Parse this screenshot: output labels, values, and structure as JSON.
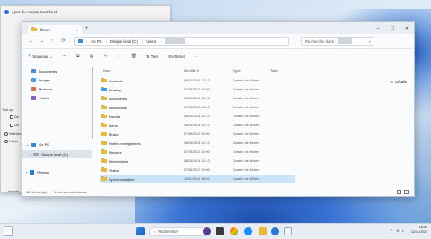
{
  "back_window": {
    "title": "Ajout du compte Nextcloud",
    "fragments": [
      "Tout sy",
      "De",
      "De",
      "Sélectio",
      "Utilise"
    ],
    "cancel_label": "Annule"
  },
  "explorer": {
    "tab_title": "dfenm",
    "tab_close": "×",
    "tab_add": "+",
    "window_controls": [
      "–",
      "☐",
      "✕"
    ],
    "nav_buttons": [
      "←",
      "→",
      "↑",
      "⟳"
    ],
    "breadcrumb": [
      "Ce PC",
      "Disque local (C:)",
      "Users"
    ],
    "breadcrumb_more": "›",
    "search_placeholder": "Rechercher dans :",
    "toolbar": {
      "new_label": "Nouveau",
      "sort_label": "Trier",
      "view_label": "Afficher",
      "more_label": "···",
      "details_label": "Détails"
    },
    "columns": {
      "name": "Nom",
      "modified": "Modifié le",
      "type": "Type",
      "size": "Taille"
    },
    "nav_pane": {
      "quick_access": [
        {
          "label": "Documents",
          "color": "#4a8fd6"
        },
        {
          "label": "Images",
          "color": "#49a0e0"
        },
        {
          "label": "Musique",
          "color": "#e0694a"
        },
        {
          "label": "Vidéos",
          "color": "#8a5bd6"
        }
      ],
      "this_pc": "Ce PC",
      "local_disk": "Disque local (C:)",
      "network": "Réseau"
    },
    "files": [
      {
        "name": "Contacts",
        "modified": "06/03/2024 12:10",
        "type": "Dossier de fichiers"
      },
      {
        "name": "Desktop",
        "modified": "07/05/2022 10:00",
        "type": "Dossier de fichiers"
      },
      {
        "name": "Documents",
        "modified": "06/03/2024 12:10",
        "type": "Dossier de fichiers"
      },
      {
        "name": "Downloads",
        "modified": "07/05/2022 10:00",
        "type": "Dossier de fichiers"
      },
      {
        "name": "Favoris",
        "modified": "06/03/2024 12:10",
        "type": "Dossier de fichiers"
      },
      {
        "name": "Liens",
        "modified": "06/03/2024 12:10",
        "type": "Dossier de fichiers"
      },
      {
        "name": "Music",
        "modified": "07/05/2022 10:00",
        "type": "Dossier de fichiers"
      },
      {
        "name": "Parties enregistrées",
        "modified": "06/03/2024 12:10",
        "type": "Dossier de fichiers"
      },
      {
        "name": "Pictures",
        "modified": "07/05/2022 10:00",
        "type": "Dossier de fichiers"
      },
      {
        "name": "Recherches",
        "modified": "06/03/2024 12:10",
        "type": "Dossier de fichiers"
      },
      {
        "name": "Videos",
        "modified": "07/05/2022 10:00",
        "type": "Dossier de fichiers"
      },
      {
        "name": "Synchronisation",
        "modified": "12/11/2024 18:59",
        "type": "Dossier de fichiers",
        "selected": true
      }
    ],
    "status": {
      "count": "12 élément(s)",
      "selected": "1 élément sélectionné"
    }
  },
  "taskbar": {
    "search_label": "Rechercher",
    "time": "18:59",
    "date": "12/11/2024",
    "accent": "#1f6fd0"
  }
}
